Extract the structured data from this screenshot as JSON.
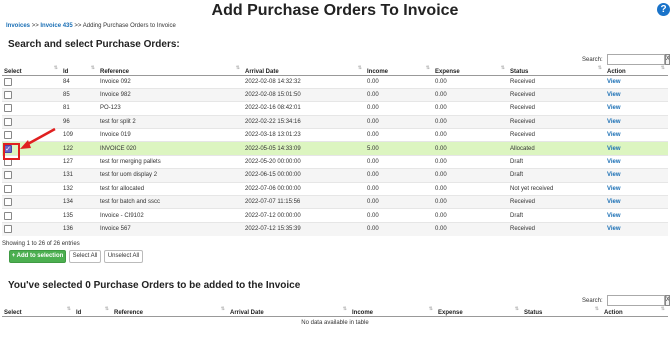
{
  "page": {
    "title": "Add Purchase Orders To Invoice",
    "help_icon": "?"
  },
  "breadcrumb": {
    "items": [
      "Invoices",
      "Invoice 435",
      "Adding Purchase Orders to Invoice"
    ],
    "separator": ">>"
  },
  "search_section": {
    "title": "Search and select Purchase Orders:",
    "search_label": "Search:",
    "search_value": "",
    "clear_label": "X"
  },
  "po_table": {
    "columns": [
      "Select",
      "Id",
      "Reference",
      "Arrival Date",
      "Income",
      "Expense",
      "Status",
      "Action"
    ],
    "rows": [
      {
        "checked": false,
        "id": "84",
        "reference": "Invoice 092",
        "arrival": "2022-02-08 14:32:32",
        "income": "0.00",
        "expense": "0.00",
        "status": "Received",
        "action": "View"
      },
      {
        "checked": false,
        "id": "85",
        "reference": "Invoice 982",
        "arrival": "2022-02-08 15:01:50",
        "income": "0.00",
        "expense": "0.00",
        "status": "Received",
        "action": "View"
      },
      {
        "checked": false,
        "id": "81",
        "reference": "PO-123",
        "arrival": "2022-02-16 08:42:01",
        "income": "0.00",
        "expense": "0.00",
        "status": "Received",
        "action": "View"
      },
      {
        "checked": false,
        "id": "96",
        "reference": "test for split 2",
        "arrival": "2022-02-22 15:34:16",
        "income": "0.00",
        "expense": "0.00",
        "status": "Received",
        "action": "View"
      },
      {
        "checked": false,
        "id": "109",
        "reference": "Invoice 019",
        "arrival": "2022-03-18 13:01:23",
        "income": "0.00",
        "expense": "0.00",
        "status": "Received",
        "action": "View"
      },
      {
        "checked": true,
        "id": "122",
        "reference": "INVOICE 020",
        "arrival": "2022-05-05 14:33:09",
        "income": "5.00",
        "expense": "0.00",
        "status": "Allocated",
        "action": "View"
      },
      {
        "checked": false,
        "id": "127",
        "reference": "test for merging pallets",
        "arrival": "2022-05-20 00:00:00",
        "income": "0.00",
        "expense": "0.00",
        "status": "Draft",
        "action": "View"
      },
      {
        "checked": false,
        "id": "131",
        "reference": "test for uom display 2",
        "arrival": "2022-06-15 00:00:00",
        "income": "0.00",
        "expense": "0.00",
        "status": "Draft",
        "action": "View"
      },
      {
        "checked": false,
        "id": "132",
        "reference": "test for allocated",
        "arrival": "2022-07-06 00:00:00",
        "income": "0.00",
        "expense": "0.00",
        "status": "Not yet received",
        "action": "View"
      },
      {
        "checked": false,
        "id": "134",
        "reference": "test for batch and sscc",
        "arrival": "2022-07-07 11:15:56",
        "income": "0.00",
        "expense": "0.00",
        "status": "Received",
        "action": "View"
      },
      {
        "checked": false,
        "id": "135",
        "reference": "Invoice - CI9102",
        "arrival": "2022-07-12 00:00:00",
        "income": "0.00",
        "expense": "0.00",
        "status": "Draft",
        "action": "View"
      },
      {
        "checked": false,
        "id": "136",
        "reference": "Invoice 567",
        "arrival": "2022-07-12 15:35:39",
        "income": "0.00",
        "expense": "0.00",
        "status": "Received",
        "action": "View"
      }
    ],
    "info": "Showing 1 to 26 of 26 entries"
  },
  "actions": {
    "add_label": "+ Add to selection",
    "select_all_label": "Select All",
    "unselect_all_label": "Unselect All"
  },
  "selected_section": {
    "title": "You've selected 0 Purchase Orders to be added to the Invoice",
    "search_label": "Search:",
    "search_value": "",
    "clear_label": "X",
    "columns": [
      "Select",
      "Id",
      "Reference",
      "Arrival Date",
      "Income",
      "Expense",
      "Status",
      "Action"
    ],
    "empty_text": "No data available in table"
  },
  "colors": {
    "link": "#1a6fb5",
    "highlight_row": "#dcf5c0",
    "annotation": "#e02020",
    "primary_button": "#4caf50"
  }
}
